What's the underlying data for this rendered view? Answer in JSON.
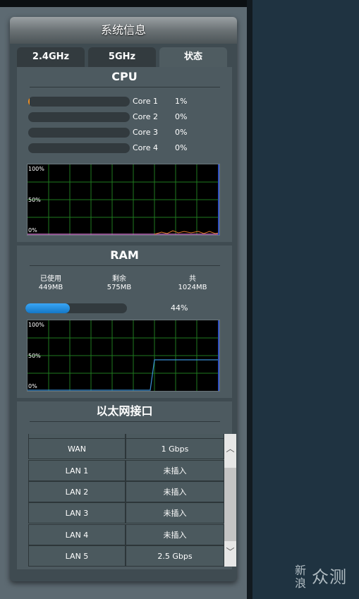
{
  "panel": {
    "title": "系统信息"
  },
  "tabs": [
    {
      "label": "2.4GHz",
      "active": false
    },
    {
      "label": "5GHz",
      "active": false
    },
    {
      "label": "状态",
      "active": true
    }
  ],
  "cpu": {
    "title": "CPU",
    "cores": [
      {
        "name": "Core 1",
        "value": "1%",
        "usage": 0.01
      },
      {
        "name": "Core 2",
        "value": "0%",
        "usage": 0
      },
      {
        "name": "Core 3",
        "value": "0%",
        "usage": 0
      },
      {
        "name": "Core 4",
        "value": "0%",
        "usage": 0
      }
    ],
    "graph_labels": {
      "top": "100%",
      "mid": "50%",
      "bottom": "0%"
    },
    "line_color": "#e07b2c"
  },
  "ram": {
    "title": "RAM",
    "used_label": "已使用",
    "used_value": "449MB",
    "free_label": "剩余",
    "free_value": "575MB",
    "total_label": "共",
    "total_value": "1024MB",
    "percent": "44%",
    "usage": 0.44,
    "graph_labels": {
      "top": "100%",
      "mid": "50%",
      "bottom": "0%"
    },
    "line_color": "#3a8fd6"
  },
  "ethernet": {
    "title": "以太网接口",
    "ports": [
      {
        "name": "WAN",
        "status": "1 Gbps"
      },
      {
        "name": "LAN 1",
        "status": "未插入"
      },
      {
        "name": "LAN 2",
        "status": "未插入"
      },
      {
        "name": "LAN 3",
        "status": "未插入"
      },
      {
        "name": "LAN 4",
        "status": "未插入"
      },
      {
        "name": "LAN 5",
        "status": "2.5 Gbps"
      }
    ]
  },
  "watermark": {
    "line1": "新浪",
    "line2": "众测"
  },
  "colors": {
    "accent_orange": "#f19124",
    "accent_blue": "#1a8ae0"
  }
}
